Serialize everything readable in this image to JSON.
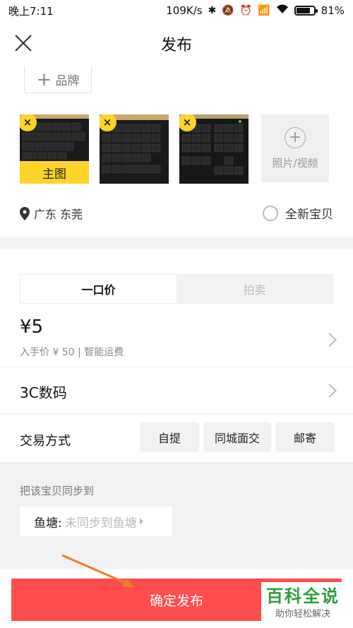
{
  "status_bar": {
    "time": "晚上7:11",
    "speed": "109K/s",
    "battery": "81%",
    "battery_level": 0.81
  },
  "header": {
    "title": "发布"
  },
  "brand": {
    "label": "品牌"
  },
  "photos": {
    "main_tag": "主图",
    "add_label": "照片/视频"
  },
  "location": {
    "text": "广东 东莞"
  },
  "condition": {
    "label": "全新宝贝"
  },
  "tabs": {
    "fixed_price": "一口价",
    "auction": "拍卖"
  },
  "price": {
    "value": "¥5",
    "sub": "入手价 ¥ 50 | 智能运费"
  },
  "category": {
    "text": "3C数码"
  },
  "trade": {
    "label": "交易方式",
    "options": [
      "自提",
      "同城面交",
      "邮寄"
    ]
  },
  "sync": {
    "label": "把该宝贝同步到",
    "fishpond_key": "鱼塘:",
    "fishpond_value": "未同步到鱼塘"
  },
  "publish": {
    "label": "确定发布"
  },
  "watermark": {
    "title": "百科全说",
    "subtitle": "助你轻松解决"
  },
  "colors": {
    "accent": "#ffd32a",
    "publish": "#ff4c4c",
    "watermark": "#2e9e3e"
  }
}
